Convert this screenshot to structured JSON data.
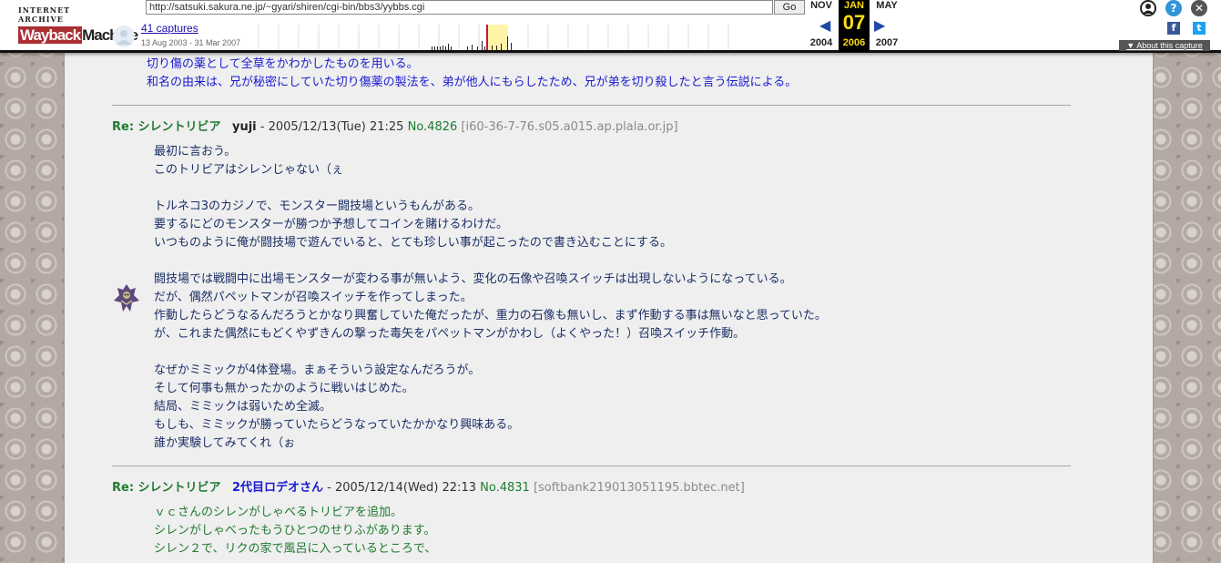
{
  "toolbar": {
    "logo_top": "INTERNET ARCHIVE",
    "logo_word1": "Wayback",
    "logo_word2": "Machine",
    "url": "http://satsuki.sakura.ne.jp/~gyari/shiren/cgi-bin/bbs3/yybbs.cgi",
    "go_label": "Go",
    "captures_label": "41 captures",
    "captures_range": "13 Aug 2003 - 31 Mar 2007",
    "prev_month": "NOV",
    "cur_month": "JAN",
    "next_month": "MAY",
    "cur_day": "07",
    "prev_year": "2004",
    "cur_year": "2006",
    "next_year": "2007",
    "about_label": "About this capture",
    "accent": "#ffdc12"
  },
  "top_lines": [
    "切り傷の薬として全草をかわかしたものを用いる。",
    "和名の由来は、兄が秘密にしていた切り傷薬の製法を、弟が他人にもらしたため、兄が弟を切り殺したと言う伝説による。"
  ],
  "posts": [
    {
      "re": "Re: シレントリビア",
      "author": "yuji",
      "date": " - 2005/12/13(Tue) 21:25 ",
      "no": "No.4826",
      "host": "[i60-36-7-76.s05.a015.ap.plala.or.jp]",
      "lines": [
        "最初に言おう。",
        "このトリビアはシレンじゃない（ぇ",
        "",
        "トルネコ3のカジノで、モンスター闘技場というもんがある。",
        "要するにどのモンスターが勝つか予想してコインを賭けるわけだ。",
        "いつものように俺が闘技場で遊んでいると、とても珍しい事が起こったので書き込むことにする。",
        "",
        "闘技場では戦闘中に出場モンスターが変わる事が無いよう、変化の石像や召喚スイッチは出現しないようになっている。",
        "だが、偶然パペットマンが召喚スイッチを作ってしまった。",
        "作動したらどうなるんだろうとかなり興奮していた俺だったが、重力の石像も無いし、まず作動する事は無いなと思っていた。",
        "が、これまた偶然にもどくやずきんの撃った毒矢をパペットマンがかわし（よくやった！）召喚スイッチ作動。",
        "",
        "なぜかミミックが4体登場。まぁそういう設定なんだろうが。",
        "そして何事も無かったかのように戦いはじめた。",
        "結局、ミミックは弱いため全滅。",
        "もしも、ミミックが勝っていたらどうなっていたかかなり興味ある。",
        "誰か実験してみてくれ（ぉ"
      ]
    },
    {
      "re": "Re: シレントリビア",
      "author": "2代目ロデオさん",
      "date": " - 2005/12/14(Wed) 22:13 ",
      "no": "No.4831",
      "host": "[softbank219013051195.bbtec.net]",
      "lines": [
        "ｖｃさんのシレンがしゃべるトリビアを追加。",
        "シレンがしゃべったもうひとつのせりふがあります。",
        "シレン２で、リクの家で風呂に入っているところで、"
      ]
    }
  ],
  "icons": {
    "user": "user-icon",
    "help": "help-icon",
    "close": "close-icon",
    "facebook": "facebook-icon",
    "twitter": "twitter-icon"
  }
}
